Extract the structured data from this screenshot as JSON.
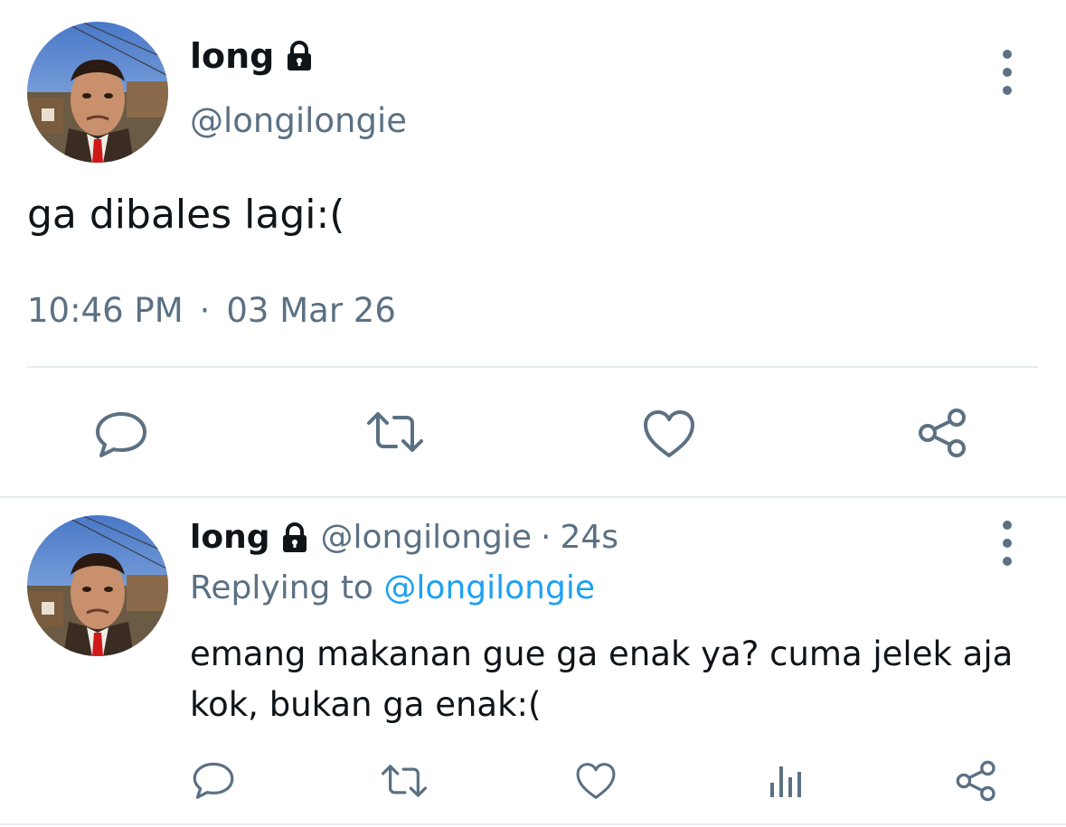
{
  "main_tweet": {
    "display_name": "long",
    "handle": "@longilongie",
    "text": "ga dibales lagi:(",
    "time": "10:46 PM",
    "separator": "·",
    "date": "03 Mar 26",
    "avatar_icon": "avatar-photo",
    "protected_icon": "lock-icon"
  },
  "main_actions": [
    {
      "name": "reply",
      "icon": "speech-bubble-icon"
    },
    {
      "name": "retweet",
      "icon": "retweet-icon"
    },
    {
      "name": "like",
      "icon": "heart-icon"
    },
    {
      "name": "share",
      "icon": "share-icon"
    }
  ],
  "reply_tweet": {
    "display_name": "long",
    "handle": "@longilongie",
    "separator": "·",
    "age": "24s",
    "replying_to_prefix": "Replying to",
    "replying_to_handle": "@longilongie",
    "text": "emang makanan gue ga enak ya? cuma jelek aja kok, bukan ga enak:("
  },
  "reply_actions": [
    {
      "name": "reply",
      "icon": "speech-bubble-icon"
    },
    {
      "name": "retweet",
      "icon": "retweet-icon"
    },
    {
      "name": "like",
      "icon": "heart-icon"
    },
    {
      "name": "analytics",
      "icon": "bar-chart-icon"
    },
    {
      "name": "share",
      "icon": "share-icon"
    }
  ],
  "colors": {
    "text": "#0f1419",
    "secondary": "#5b7083",
    "link": "#1da1f2",
    "divider": "#e6ecf0"
  }
}
